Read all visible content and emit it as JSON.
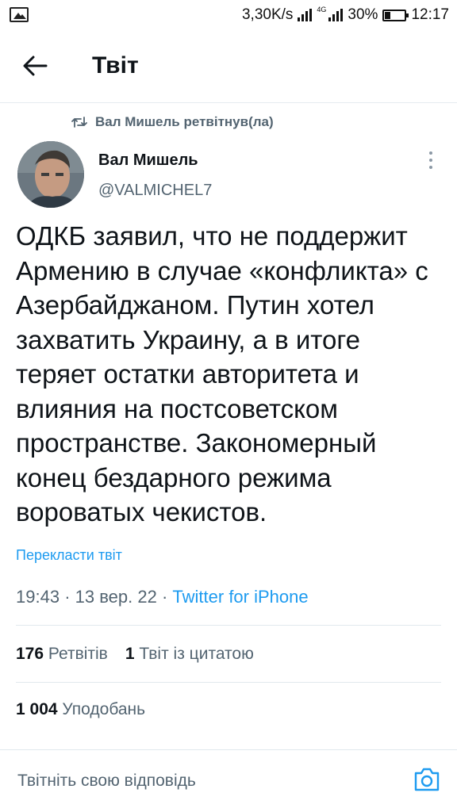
{
  "status_bar": {
    "speed": "3,30K/s",
    "network": "4G",
    "battery": "30%",
    "battery_fraction": 0.3,
    "time": "12:17"
  },
  "header": {
    "title": "Твіт"
  },
  "retweet": {
    "label": "Вал Мишель ретвітнув(ла)"
  },
  "author": {
    "name": "Вал Мишель",
    "handle": "@VALMICHEL7"
  },
  "tweet": {
    "text": "ОДКБ заявил, что не поддержит Армению в случае «конфликта» с Азербайджаном. Путин хотел захватить Украину, а в итоге теряет остатки авторитета и влияния на постсоветском пространстве. Закономерный конец бездарного режима вороватых чекистов.",
    "translate": "Перекласти твіт",
    "time": "19:43",
    "date": "13 вер. 22",
    "source": "Twitter for iPhone"
  },
  "stats": {
    "retweets_count": "176",
    "retweets_label": "Ретвітів",
    "quotes_count": "1",
    "quotes_label": "Твіт із цитатою",
    "likes_count": "1 004",
    "likes_label": "Уподобань"
  },
  "reply": {
    "placeholder": "Твітніть свою відповідь"
  },
  "colors": {
    "accent": "#1d9bf0",
    "secondary_text": "#536471",
    "primary_text": "#0f1419"
  }
}
